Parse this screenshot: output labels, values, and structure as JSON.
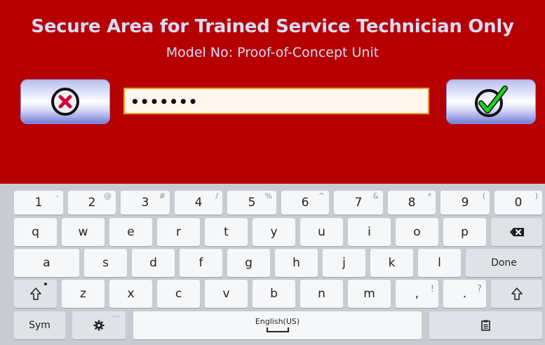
{
  "header": {
    "title": "Secure Area for Trained Service Technician Only",
    "subtitle": "Model No: Proof-of-Concept Unit"
  },
  "login": {
    "password_value": "•••••••",
    "cancel_icon": "cancel-x-icon",
    "ok_icon": "checkmark-icon"
  },
  "keyboard": {
    "number_row": [
      {
        "label": "1",
        "secondary": "-"
      },
      {
        "label": "2",
        "secondary": "@"
      },
      {
        "label": "3",
        "secondary": "#"
      },
      {
        "label": "4",
        "secondary": "/"
      },
      {
        "label": "5",
        "secondary": "%"
      },
      {
        "label": "6",
        "secondary": "^"
      },
      {
        "label": "7",
        "secondary": "&"
      },
      {
        "label": "8",
        "secondary": "*"
      },
      {
        "label": "9",
        "secondary": "("
      },
      {
        "label": "0",
        "secondary": ")"
      }
    ],
    "row_q": [
      "q",
      "w",
      "e",
      "r",
      "t",
      "y",
      "u",
      "i",
      "o",
      "p"
    ],
    "row_a": [
      "a",
      "s",
      "d",
      "f",
      "g",
      "h",
      "j",
      "k",
      "l"
    ],
    "row_z": [
      "z",
      "x",
      "c",
      "v",
      "b",
      "n",
      "m"
    ],
    "comma": {
      "label": ",",
      "secondary": "!"
    },
    "period": {
      "label": ".",
      "secondary": "?"
    },
    "done_label": "Done",
    "sym_label": "Sym",
    "settings_secondary": "...",
    "space_label": "English(US)"
  },
  "colors": {
    "panel_bg": "#b60000",
    "title_text": "#d9dcf6",
    "field_border": "#f29b2e",
    "keyboard_bg": "#c8ccd2"
  }
}
